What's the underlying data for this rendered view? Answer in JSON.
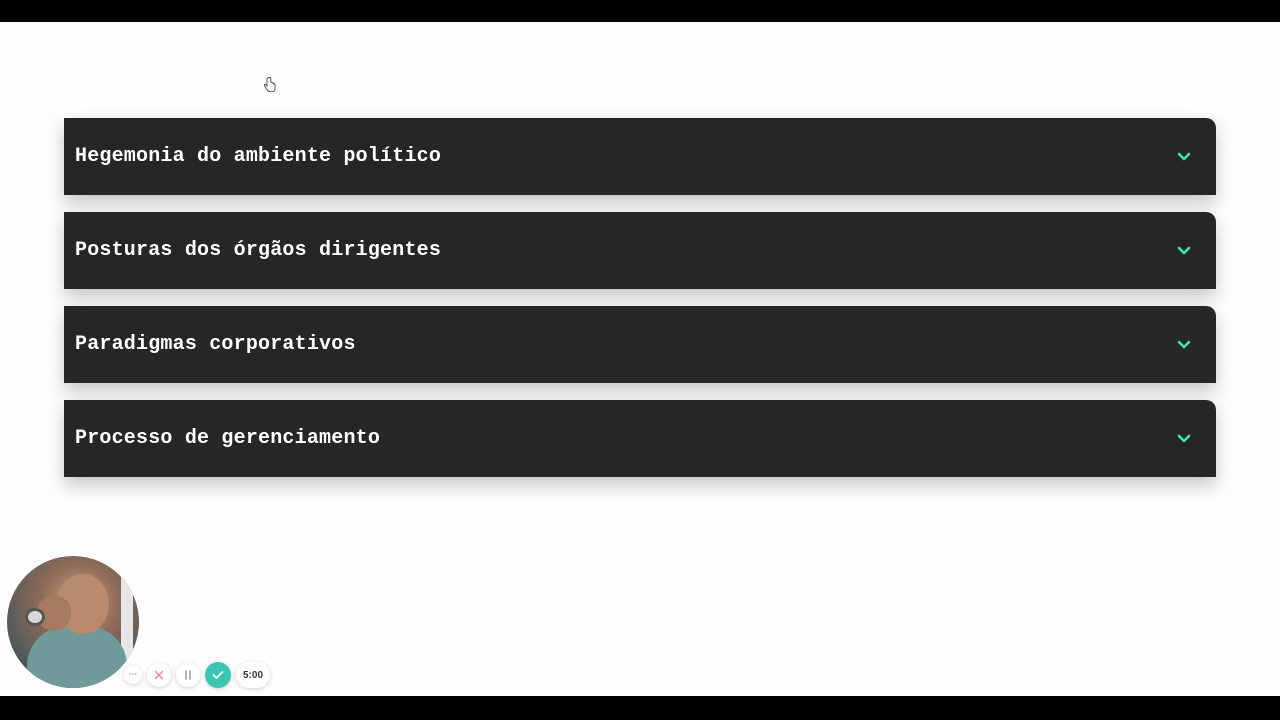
{
  "accordion": {
    "items": [
      {
        "title": "Hegemonia do ambiente político"
      },
      {
        "title": "Posturas dos órgãos dirigentes"
      },
      {
        "title": "Paradigmas corporativos"
      },
      {
        "title": "Processo de gerenciamento"
      }
    ],
    "chevron_icon": "chevron-down-icon",
    "chevron_color": "#3ee6b8",
    "panel_color": "#262626"
  },
  "recorder": {
    "more_label": "···",
    "timer": "5:00",
    "cancel_icon": "close-icon",
    "pause_icon": "pause-icon",
    "done_icon": "check-icon",
    "accent_color": "#3cc5b3"
  }
}
